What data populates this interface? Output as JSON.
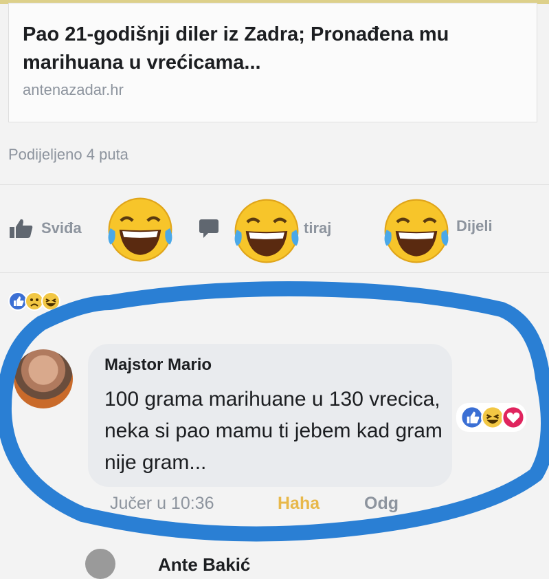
{
  "post": {
    "link_title": "Pao 21-godišnji diler iz Zadra; Pronađena mu marihuana u vrećicama...",
    "link_domain": "antenazadar.hr",
    "shares": "Podijeljeno 4 puta"
  },
  "actions": {
    "like_label": "Sviđa",
    "comment_label": "tiraj",
    "share_label": "Dijeli"
  },
  "reaction_summary": {
    "icons": [
      "like-icon",
      "sad-icon",
      "haha-icon"
    ]
  },
  "overlay": {
    "emoji": "laughing-tears-emoji",
    "annotation_color": "#2a7fd4"
  },
  "comment": {
    "author": "Majstor Mario",
    "text": "100 grama marihuane u 130 vrecica, neka si pao mamu ti jebem kad gram nije gram...",
    "time": "Jučer u 10:36",
    "haha": "Haha",
    "reply": "Odg",
    "reactions": [
      "like-icon",
      "haha-icon",
      "love-icon"
    ]
  },
  "next_comment": {
    "author": "Ante Bakić"
  },
  "colors": {
    "accent": "#3b6fd4",
    "muted": "#8d949e",
    "haha": "#e8b84a"
  }
}
